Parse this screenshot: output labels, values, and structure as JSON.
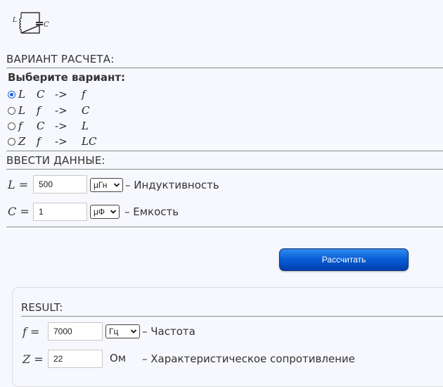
{
  "circuit_icon": {
    "L": "L",
    "C": "C"
  },
  "variant_section": {
    "title": "ВАРИАНТ РАСЧЕТА:",
    "prompt": "Выберите вариант:"
  },
  "variants": [
    {
      "a": "L",
      "b": "C",
      "arrow": "->",
      "c": "f",
      "checked": true
    },
    {
      "a": "L",
      "b": "f",
      "arrow": "->",
      "c": "C",
      "checked": false
    },
    {
      "a": "f",
      "b": "C",
      "arrow": "->",
      "c": "L",
      "checked": false
    },
    {
      "a": "Z",
      "b": "f",
      "arrow": "->",
      "c": "LC",
      "checked": false
    }
  ],
  "input_section": {
    "title": "ВВЕСТИ ДАННЫЕ:",
    "L": {
      "symbol": "L =",
      "value": "500",
      "unit": "μГн",
      "description": "– Индуктивность"
    },
    "C": {
      "symbol": "C =",
      "value": "1",
      "unit": "μФ",
      "description": "– Емкость"
    }
  },
  "calculate_button": {
    "label": "Рассчитать"
  },
  "result": {
    "title": "RESULT:",
    "f": {
      "symbol": "f =",
      "value": "7000",
      "unit": "Гц",
      "description": "– Частота"
    },
    "Z": {
      "symbol": "Z =",
      "value": "22",
      "unit": "Ом",
      "description": "– Характеристическое сопротивление"
    }
  },
  "colors": {
    "accent": "#1a5fcf",
    "button_top": "#2f8cf0",
    "button_bottom": "#003fae",
    "background": "#f7f8fd"
  }
}
